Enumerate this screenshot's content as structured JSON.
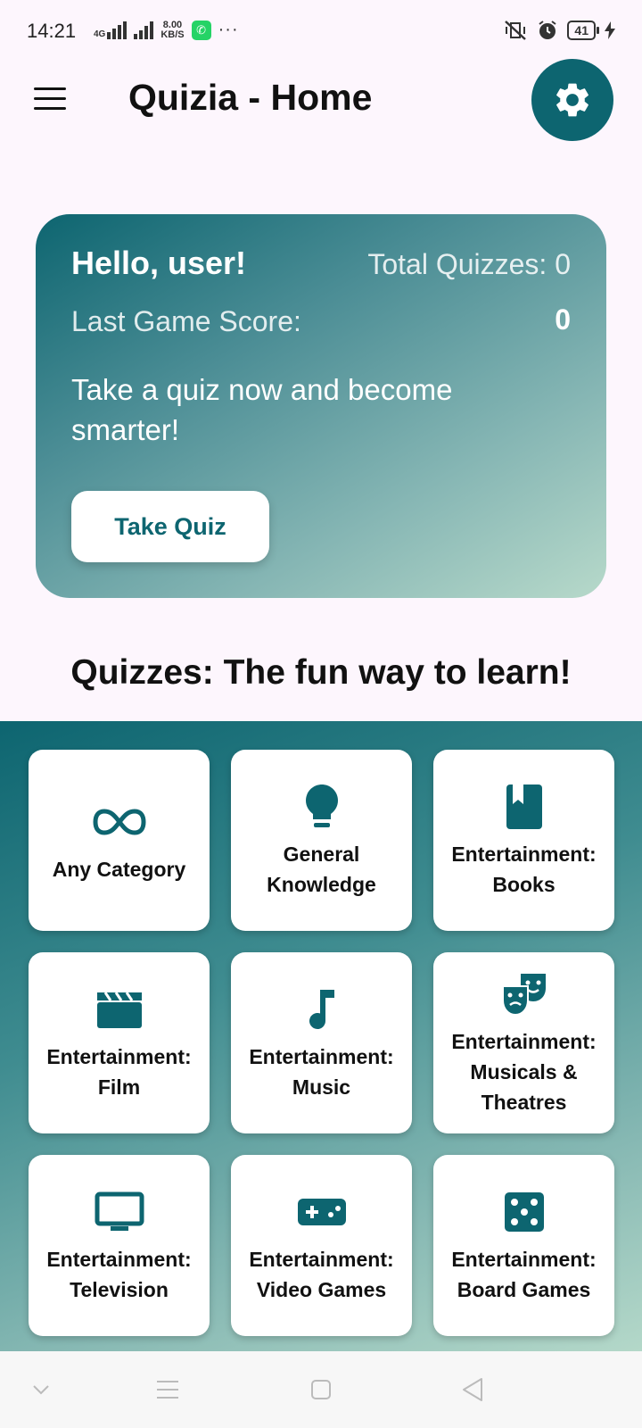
{
  "status_bar": {
    "time": "14:21",
    "network": "4G",
    "speed": "8.00",
    "speed_unit": "KB/S",
    "more": "···",
    "battery": "41"
  },
  "appbar": {
    "title": "Quizia - Home"
  },
  "hero": {
    "greeting": "Hello, user!",
    "total_quizzes": "Total Quizzes: 0",
    "last_score_label": "Last Game Score:",
    "last_score_value": "0",
    "tagline": "Take a quiz now and become smarter!",
    "button": "Take Quiz"
  },
  "section_title": "Quizzes: The fun way to learn!",
  "categories": [
    {
      "label": "Any Category",
      "icon": "infinity-icon"
    },
    {
      "label": "General Knowledge",
      "icon": "lightbulb-icon"
    },
    {
      "label": "Entertainment: Books",
      "icon": "book-icon"
    },
    {
      "label": "Entertainment: Film",
      "icon": "clapperboard-icon"
    },
    {
      "label": "Entertainment: Music",
      "icon": "music-note-icon"
    },
    {
      "label": "Entertainment: Musicals & Theatres",
      "icon": "theater-masks-icon"
    },
    {
      "label": "Entertainment: Television",
      "icon": "television-icon"
    },
    {
      "label": "Entertainment: Video Games",
      "icon": "gamepad-icon"
    },
    {
      "label": "Entertainment: Board Games",
      "icon": "dice-icon"
    }
  ],
  "colors": {
    "primary": "#0d6570",
    "background": "#fdf6fd"
  }
}
